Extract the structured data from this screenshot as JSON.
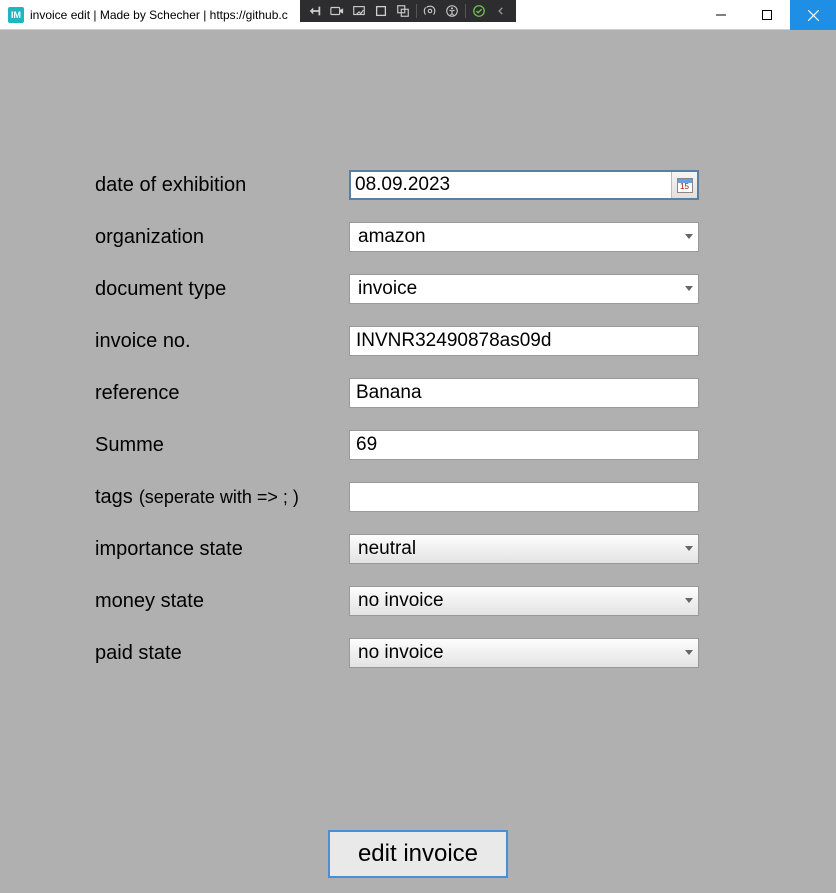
{
  "window": {
    "title": "invoice edit | Made by Schecher | https://github.c",
    "app_icon_text": "IM"
  },
  "form": {
    "date_label": "date of exhibition",
    "date_value": "08.09.2023",
    "calendar_day": "15",
    "org_label": "organization",
    "org_value": "amazon",
    "doctype_label": "document type",
    "doctype_value": "invoice",
    "invoiceno_label": "invoice no.",
    "invoiceno_value": "INVNR32490878as09d",
    "reference_label": "reference",
    "reference_value": "Banana",
    "sum_label": "Summe",
    "sum_value": "69",
    "tags_label": "tags",
    "tags_hint": "(seperate with => ; )",
    "tags_value": "",
    "importance_label": "importance state",
    "importance_value": "neutral",
    "money_label": "money state",
    "money_value": "no invoice",
    "paid_label": "paid state",
    "paid_value": "no invoice"
  },
  "actions": {
    "submit_label": "edit invoice"
  }
}
